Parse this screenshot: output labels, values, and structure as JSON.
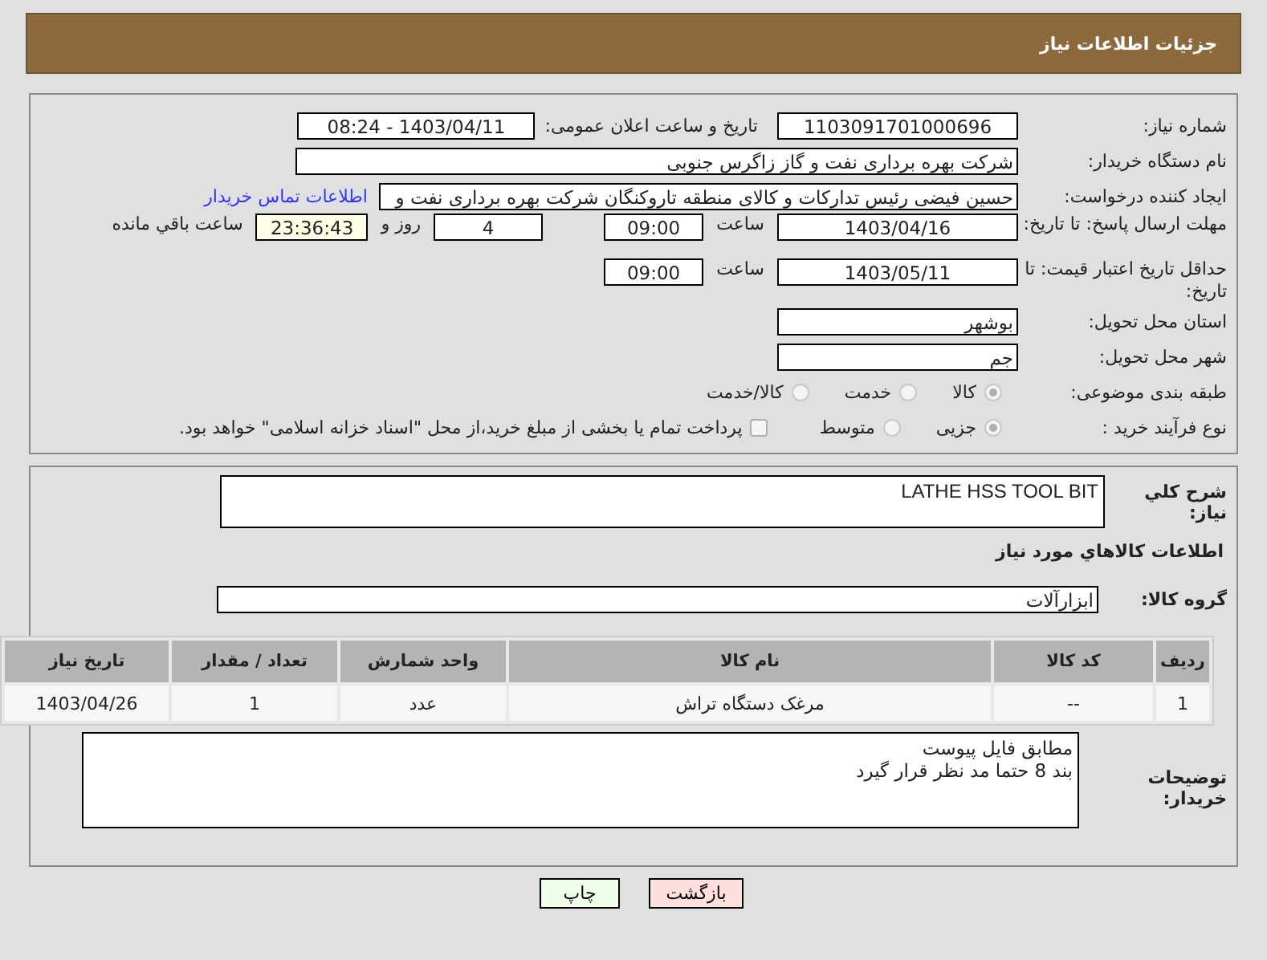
{
  "header": {
    "title": "جزئیات اطلاعات نیاز"
  },
  "need_number": {
    "label": "شماره نیاز:",
    "value": "1103091701000696"
  },
  "announce": {
    "label": "تاریخ و ساعت اعلان عمومی:",
    "value": "1403/04/11 - 08:24"
  },
  "buyer": {
    "label": "نام دستگاه خریدار:",
    "value": "شرکت بهره برداری نفت و گاز زاگرس جنوبی"
  },
  "creator": {
    "label": "ایجاد کننده درخواست:",
    "value": "حسین فیضی رئیس تدارکات و کالای منطقه تاروکنگان شرکت بهره برداری نفت و",
    "link": "اطلاعات تماس خریدار"
  },
  "reply_deadline": {
    "label": "مهلت ارسال پاسخ: تا تاریخ:",
    "date": "1403/04/16",
    "time_label": "ساعت",
    "time": "09:00",
    "days": "4",
    "days_label": "روز و",
    "remaining": "23:36:43",
    "remaining_label": "ساعت باقي مانده"
  },
  "price_validity": {
    "label": "حداقل تاریخ اعتبار قیمت: تا تاریخ:",
    "date": "1403/05/11",
    "time_label": "ساعت",
    "time": "09:00"
  },
  "province": {
    "label": "استان محل تحویل:",
    "value": "بوشهر"
  },
  "city": {
    "label": "شهر محل تحویل:",
    "value": "جم"
  },
  "category": {
    "label": "طبقه بندی موضوعی:",
    "options": [
      {
        "label": "کالا",
        "selected": true
      },
      {
        "label": "خدمت",
        "selected": false
      },
      {
        "label": "کالا/خدمت",
        "selected": false
      }
    ]
  },
  "process": {
    "label": "نوع فرآیند خرید :",
    "options": [
      {
        "label": "جزیی",
        "selected": true
      },
      {
        "label": "متوسط",
        "selected": false
      }
    ],
    "treasury": {
      "label": "پرداخت تمام یا بخشی از مبلغ خرید،از محل \"اسناد خزانه اسلامی\" خواهد بود.",
      "checked": false
    }
  },
  "description": {
    "label": "شرح كلي نياز:",
    "value": "LATHE HSS TOOL BIT"
  },
  "goods_heading": "اطلاعات كالاهاي مورد نياز",
  "group": {
    "label": "گروه کالا:",
    "value": "ابزارآلات"
  },
  "table": {
    "columns": [
      "ردیف",
      "کد کالا",
      "نام کالا",
      "واحد شمارش",
      "تعداد / مقدار",
      "تاریخ نیاز"
    ],
    "rows": [
      [
        "1",
        "--",
        "مرغک دستگاه تراش",
        "عدد",
        "1",
        "1403/04/26"
      ]
    ]
  },
  "notes": {
    "label": "توضیحات خریدار:",
    "lines": [
      "مطابق فایل پیوست",
      "بند 8 حتما مد نظر قرار گیرد"
    ]
  },
  "buttons": [
    {
      "kind": "back",
      "label": "بازگشت"
    },
    {
      "kind": "print",
      "label": "چاپ"
    }
  ]
}
